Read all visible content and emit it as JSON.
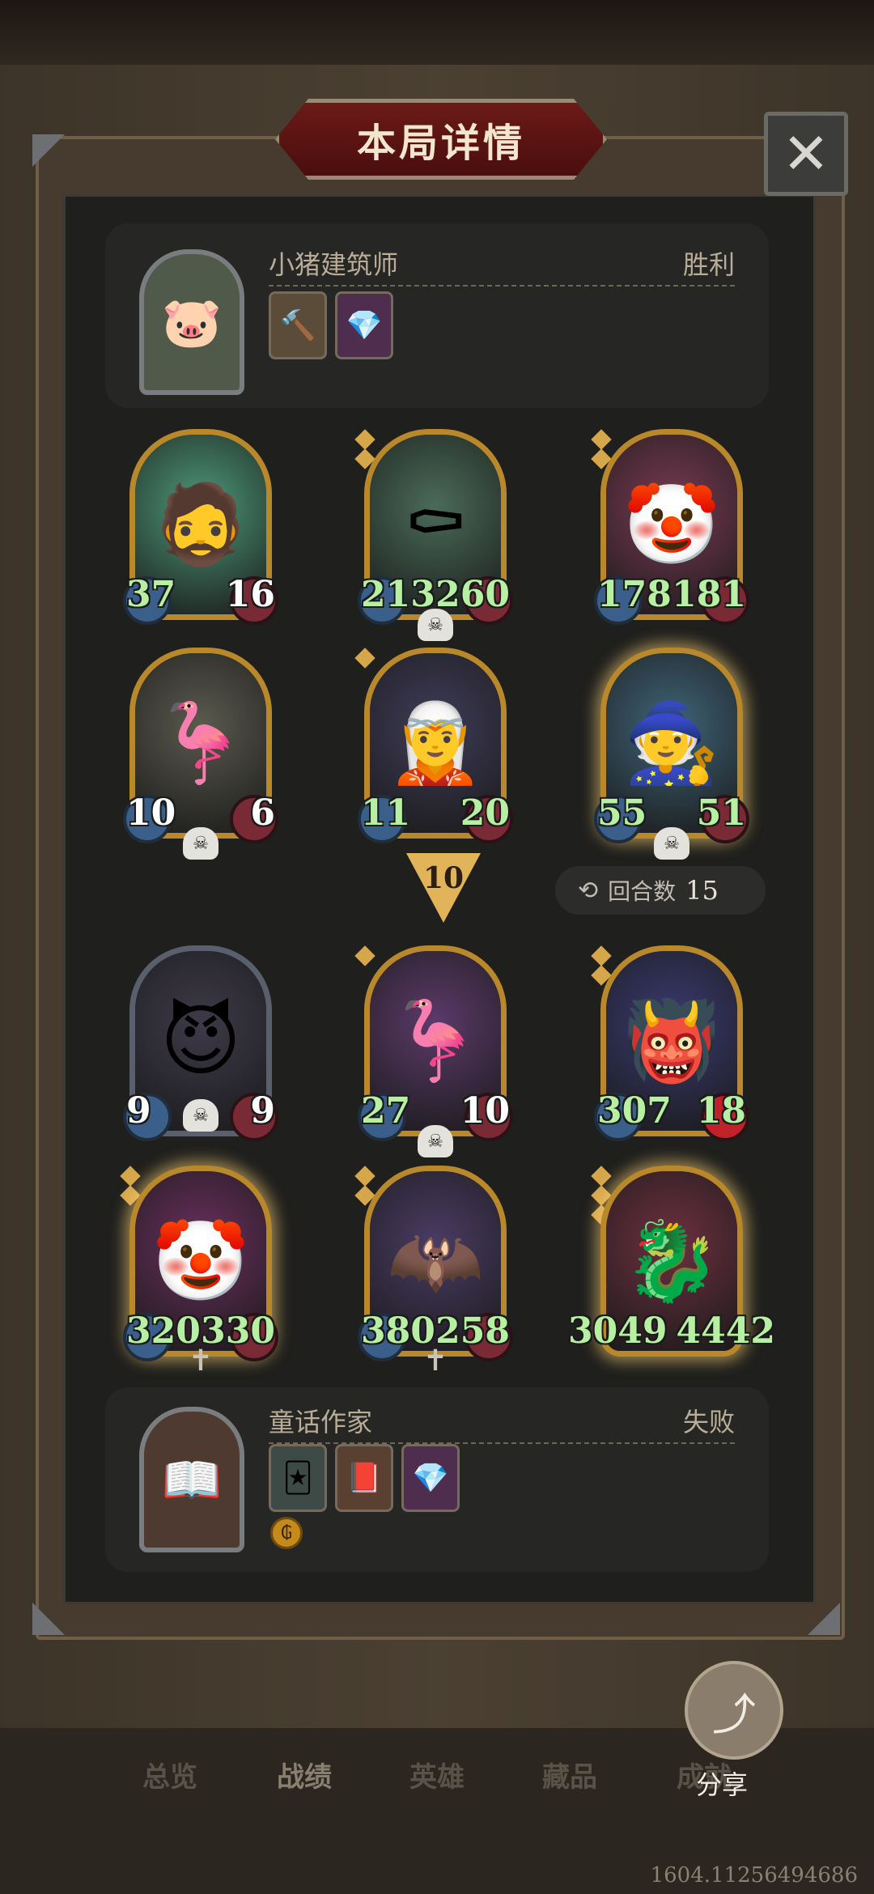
{
  "title": "本局详情",
  "close_icon": "close-icon",
  "winner": {
    "name": "小猪建筑师",
    "result": "胜利",
    "portrait_icon": "pig-hero-portrait",
    "items": [
      "hammer-item",
      "gem-item"
    ]
  },
  "loser": {
    "name": "童话作家",
    "result": "失败",
    "portrait_icon": "writer-hero-portrait",
    "items": [
      "writer-card-item",
      "book-item",
      "gem-item"
    ],
    "coin_icon": "dragon-coin-icon"
  },
  "tier_value": "10",
  "round": {
    "label": "回合数",
    "value": "15"
  },
  "cards": {
    "c1": {
      "atk": "37",
      "hp": "16",
      "icon": "sailor-minion",
      "color": "#4d9a7a"
    },
    "c2": {
      "atk": "213",
      "hp": "260",
      "icon": "ghost-coffin-minion",
      "color": "#4a6b59"
    },
    "c3": {
      "atk": "178",
      "hp": "181",
      "icon": "clown-minion",
      "color": "#7a3a52"
    },
    "c4": {
      "atk": "10",
      "hp": "6",
      "icon": "pelican-minion",
      "color": "#5b5a4e"
    },
    "c5": {
      "atk": "11",
      "hp": "20",
      "icon": "elf-sorceress-minion",
      "color": "#3f3c58"
    },
    "c6": {
      "atk": "55",
      "hp": "51",
      "icon": "wizard-minion",
      "color": "#3f6478"
    },
    "c7": {
      "atk": "9",
      "hp": "9",
      "icon": "horned-girl-minion",
      "color": "#3e3a4a"
    },
    "c8": {
      "atk": "27",
      "hp": "10",
      "icon": "pelican-minion",
      "color": "#5c3a6a"
    },
    "c9": {
      "atk": "307",
      "hp": "18",
      "icon": "shadow-beast-minion",
      "color": "#3b3a72"
    },
    "c10": {
      "atk": "320",
      "hp": "330",
      "icon": "clown-minion",
      "color": "#6b2f5e"
    },
    "c11": {
      "atk": "380",
      "hp": "258",
      "icon": "bat-demon-minion",
      "color": "#4a3c64"
    },
    "c12": {
      "atk": "3049",
      "hp": "4442",
      "icon": "red-dragon-minion",
      "color": "#6e3040"
    }
  },
  "share": {
    "label": "分享",
    "icon": "share-icon"
  },
  "nav": [
    {
      "label": "总览"
    },
    {
      "label": "战绩"
    },
    {
      "label": "英雄"
    },
    {
      "label": "藏品"
    },
    {
      "label": "成就"
    }
  ],
  "build_id": "1604.11256494686"
}
